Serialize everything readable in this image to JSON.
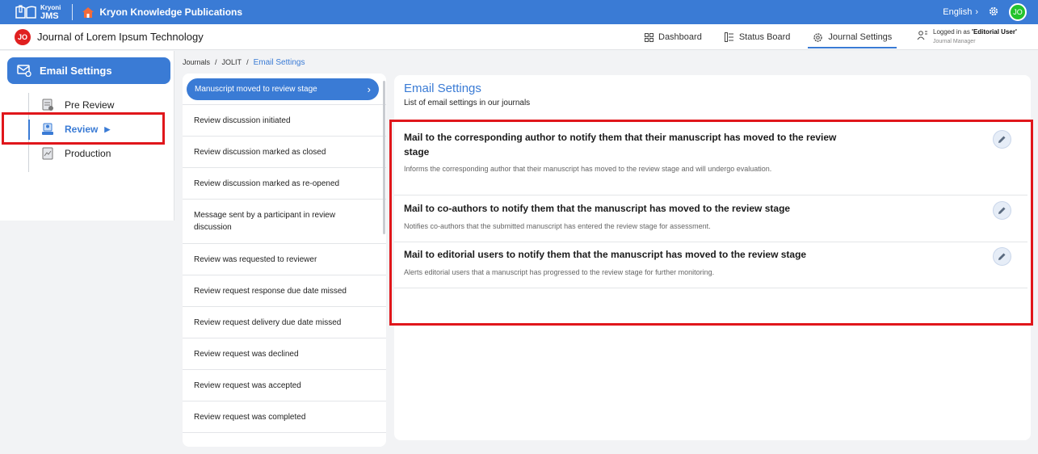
{
  "topbar": {
    "logo_line1": "Kryoni",
    "logo_line2": "JMS",
    "publisher": "Kryon Knowledge Publications",
    "language": "English",
    "user_initials": "JO",
    "accent_color": "#3a7bd5"
  },
  "journal": {
    "initials": "JO",
    "name": "Journal of Lorem Ipsum Technology"
  },
  "nav": {
    "items": [
      {
        "label": "Dashboard",
        "icon": "grid-icon"
      },
      {
        "label": "Status Board",
        "icon": "status-board-icon"
      },
      {
        "label": "Journal Settings",
        "icon": "journal-settings-icon"
      }
    ],
    "active": "Journal Settings",
    "logged_in_prefix": "Logged in as ",
    "logged_in_user": "'Editorial User'",
    "role": "Journal Manager"
  },
  "sidebar": {
    "section": "Email Settings",
    "items": [
      {
        "label": "Pre Review",
        "icon": "pre-review-icon"
      },
      {
        "label": "Review",
        "icon": "review-icon"
      },
      {
        "label": "Production",
        "icon": "production-icon"
      }
    ],
    "active": "Review"
  },
  "breadcrumb": [
    "Journals",
    "JOLIT",
    "Email Settings"
  ],
  "events": {
    "active": "Manuscript moved to review stage",
    "items": [
      "Review discussion initiated",
      "Review discussion marked as closed",
      "Review discussion marked as re-opened",
      "Message sent by a participant in review discussion",
      "Review was requested to reviewer",
      "Review request response due date missed",
      "Review request delivery due date missed",
      "Review request was declined",
      "Review request was accepted",
      "Review request was completed"
    ]
  },
  "panel": {
    "title": "Email Settings",
    "subtitle": "List of email settings in our journals",
    "mails": [
      {
        "title": "Mail to the corresponding author to notify them that their manuscript has moved to the review stage",
        "description": "Informs the corresponding author that their manuscript has moved to the review stage and will undergo evaluation."
      },
      {
        "title": "Mail to co-authors to notify them that the manuscript has moved to the review stage",
        "description": "Notifies co-authors that the submitted manuscript has entered the review stage for assessment."
      },
      {
        "title": "Mail to editorial users to notify them that the manuscript has moved to the review stage",
        "description": "Alerts editorial users that a manuscript has progressed to the review stage for further monitoring."
      }
    ]
  },
  "highlight_color": "#e0161b"
}
